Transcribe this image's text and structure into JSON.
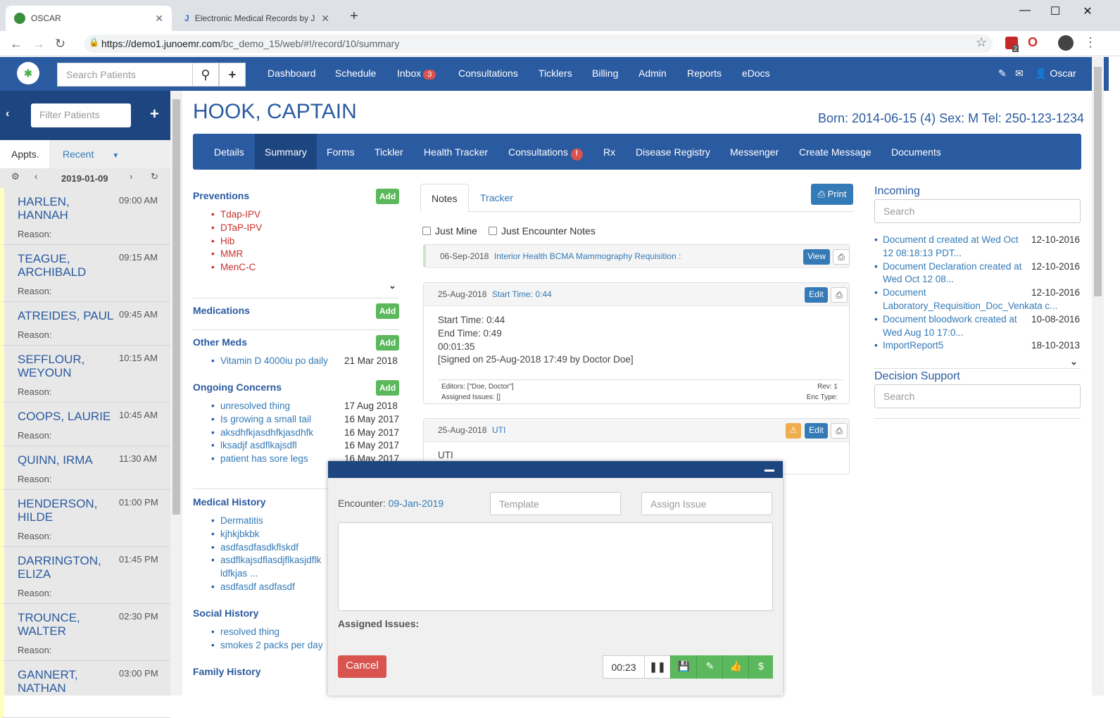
{
  "browser": {
    "tabs": [
      {
        "title": "OSCAR",
        "active": true
      },
      {
        "title": "Electronic Medical Records by Ju",
        "active": false
      }
    ],
    "url_host": "https://demo1.junoemr.com",
    "url_path": "/bc_demo_15/web/#!/record/10/summary",
    "ext_badge": "2"
  },
  "topnav": {
    "search_placeholder": "Search Patients",
    "items": [
      "Dashboard",
      "Schedule",
      "Inbox",
      "Consultations",
      "Ticklers",
      "Billing",
      "Admin",
      "Reports",
      "eDocs"
    ],
    "inbox_count": "3",
    "user": "Oscar"
  },
  "sidebar": {
    "filter_placeholder": "Filter Patients",
    "tab_appts": "Appts.",
    "tab_recent": "Recent",
    "date": "2019-01-09",
    "reason_label": "Reason:",
    "appointments": [
      {
        "name": "HARLEN, HANNAH",
        "time": "09:00 AM"
      },
      {
        "name": "TEAGUE, ARCHIBALD",
        "time": "09:15 AM"
      },
      {
        "name": "ATREIDES, PAUL",
        "time": "09:45 AM"
      },
      {
        "name": "SEFFLOUR, WEYOUN",
        "time": "10:15 AM"
      },
      {
        "name": "COOPS, LAURIE",
        "time": "10:45 AM"
      },
      {
        "name": "QUINN, IRMA",
        "time": "11:30 AM"
      },
      {
        "name": "HENDERSON, HILDE",
        "time": "01:00 PM"
      },
      {
        "name": "DARRINGTON, ELIZA",
        "time": "01:45 PM"
      },
      {
        "name": "TROUNCE, WALTER",
        "time": "02:30 PM"
      },
      {
        "name": "GANNERT, NATHAN",
        "time": "03:00 PM"
      }
    ]
  },
  "patient": {
    "name": "HOOK, CAPTAIN",
    "info": "Born: 2014-06-15 (4) Sex: M Tel: 250-123-1234",
    "tabs": [
      "Details",
      "Summary",
      "Forms",
      "Tickler",
      "Health Tracker",
      "Consultations",
      "Rx",
      "Disease Registry",
      "Messenger",
      "Create Message",
      "Documents"
    ],
    "consult_alert": "!"
  },
  "summary": {
    "add_label": "Add",
    "preventions": {
      "title": "Preventions",
      "items": [
        "Tdap-IPV",
        "DTaP-IPV",
        "Hib",
        "MMR",
        "MenC-C"
      ]
    },
    "medications": {
      "title": "Medications"
    },
    "other_meds": {
      "title": "Other Meds",
      "items": [
        {
          "text": "Vitamin D 4000iu po daily",
          "date": "21 Mar 2018"
        }
      ]
    },
    "ongoing": {
      "title": "Ongoing Concerns",
      "items": [
        {
          "text": "unresolved thing",
          "date": "17 Aug 2018"
        },
        {
          "text": "Is growing a small tail",
          "date": "16 May 2017"
        },
        {
          "text": "aksdhfkjasdhfkjasdhfk",
          "date": "16 May 2017"
        },
        {
          "text": "lksadjf asdflkajsdfl",
          "date": "16 May 2017"
        },
        {
          "text": "patient has sore legs",
          "date": "16 May 2017"
        }
      ]
    },
    "medical_history": {
      "title": "Medical History",
      "items": [
        "Dermatitis",
        "kjhkjbkbk",
        "asdfasdfasdkflskdf",
        "asdflkajsdflasdjflkasjdflk ldfkjas ...",
        "asdfasdf asdfasdf"
      ]
    },
    "social_history": {
      "title": "Social History",
      "items": [
        "resolved thing",
        "smokes 2 packs per day"
      ]
    },
    "family_history": {
      "title": "Family History"
    }
  },
  "notes": {
    "tab_notes": "Notes",
    "tab_tracker": "Tracker",
    "print_label": "Print",
    "just_mine": "Just Mine",
    "just_encounter": "Just Encounter Notes",
    "view_label": "View",
    "edit_label": "Edit",
    "entries": [
      {
        "date": "06-Sep-2018",
        "title": "Interior Health BCMA Mammography Requisition :"
      },
      {
        "date": "25-Aug-2018",
        "title": "Start Time: 0:44",
        "body": [
          "Start Time: 0:44",
          "End Time: 0:49",
          "00:01:35",
          "[Signed on 25-Aug-2018 17:49 by Doctor Doe]"
        ],
        "editors": "Editors: [\"Doe, Doctor\"]",
        "issues": "Assigned Issues: []",
        "rev": "Rev: 1",
        "enc_type": "Enc Type:"
      },
      {
        "date": "25-Aug-2018",
        "title": "UTI",
        "body": [
          "UTI"
        ]
      }
    ]
  },
  "incoming": {
    "title": "Incoming",
    "search_placeholder": "Search",
    "items": [
      {
        "text": "Document d created at Wed Oct 12 08:18:13 PDT...",
        "date": "12-10-2016"
      },
      {
        "text": "Document Declaration created at Wed Oct 12 08...",
        "date": "12-10-2016"
      },
      {
        "text": "Document Laboratory_Requisition_Doc_Venkata c...",
        "date": "12-10-2016"
      },
      {
        "text": "Document bloodwork created at Wed Aug 10 17:0...",
        "date": "10-08-2016"
      },
      {
        "text": "ImportReport5",
        "date": "18-10-2013"
      }
    ]
  },
  "decision_support": {
    "title": "Decision Support",
    "search_placeholder": "Search"
  },
  "encounter": {
    "label": "Encounter:",
    "date": "09-Jan-2019",
    "template_placeholder": "Template",
    "assign_placeholder": "Assign Issue",
    "assigned_label": "Assigned Issues:",
    "cancel_label": "Cancel",
    "timer": "00:23"
  },
  "colors": {
    "nav": "#2a5aa0",
    "nav_dark": "#1d4680",
    "success": "#5cb85c",
    "danger": "#d9534f"
  }
}
